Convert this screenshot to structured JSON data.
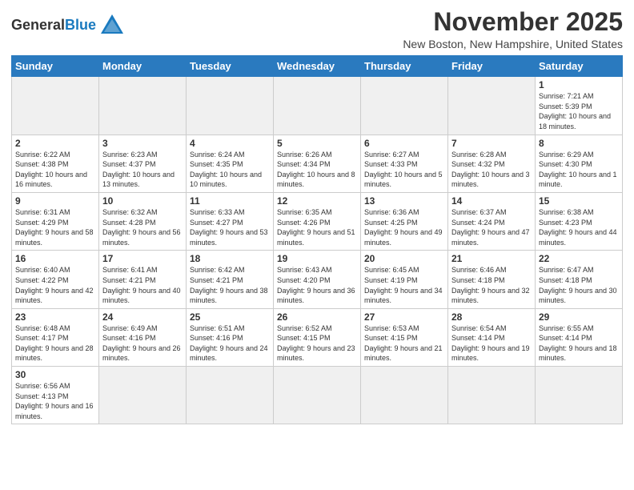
{
  "logo": {
    "text_general": "General",
    "text_blue": "Blue"
  },
  "header": {
    "month_year": "November 2025",
    "location": "New Boston, New Hampshire, United States"
  },
  "weekdays": [
    "Sunday",
    "Monday",
    "Tuesday",
    "Wednesday",
    "Thursday",
    "Friday",
    "Saturday"
  ],
  "weeks": [
    [
      {
        "day": "",
        "info": "",
        "empty": true
      },
      {
        "day": "",
        "info": "",
        "empty": true
      },
      {
        "day": "",
        "info": "",
        "empty": true
      },
      {
        "day": "",
        "info": "",
        "empty": true
      },
      {
        "day": "",
        "info": "",
        "empty": true
      },
      {
        "day": "",
        "info": "",
        "empty": true
      },
      {
        "day": "1",
        "info": "Sunrise: 7:21 AM\nSunset: 5:39 PM\nDaylight: 10 hours and 18 minutes.",
        "empty": false
      }
    ],
    [
      {
        "day": "2",
        "info": "Sunrise: 6:22 AM\nSunset: 4:38 PM\nDaylight: 10 hours and 16 minutes.",
        "empty": false
      },
      {
        "day": "3",
        "info": "Sunrise: 6:23 AM\nSunset: 4:37 PM\nDaylight: 10 hours and 13 minutes.",
        "empty": false
      },
      {
        "day": "4",
        "info": "Sunrise: 6:24 AM\nSunset: 4:35 PM\nDaylight: 10 hours and 10 minutes.",
        "empty": false
      },
      {
        "day": "5",
        "info": "Sunrise: 6:26 AM\nSunset: 4:34 PM\nDaylight: 10 hours and 8 minutes.",
        "empty": false
      },
      {
        "day": "6",
        "info": "Sunrise: 6:27 AM\nSunset: 4:33 PM\nDaylight: 10 hours and 5 minutes.",
        "empty": false
      },
      {
        "day": "7",
        "info": "Sunrise: 6:28 AM\nSunset: 4:32 PM\nDaylight: 10 hours and 3 minutes.",
        "empty": false
      },
      {
        "day": "8",
        "info": "Sunrise: 6:29 AM\nSunset: 4:30 PM\nDaylight: 10 hours and 1 minute.",
        "empty": false
      }
    ],
    [
      {
        "day": "9",
        "info": "Sunrise: 6:31 AM\nSunset: 4:29 PM\nDaylight: 9 hours and 58 minutes.",
        "empty": false
      },
      {
        "day": "10",
        "info": "Sunrise: 6:32 AM\nSunset: 4:28 PM\nDaylight: 9 hours and 56 minutes.",
        "empty": false
      },
      {
        "day": "11",
        "info": "Sunrise: 6:33 AM\nSunset: 4:27 PM\nDaylight: 9 hours and 53 minutes.",
        "empty": false
      },
      {
        "day": "12",
        "info": "Sunrise: 6:35 AM\nSunset: 4:26 PM\nDaylight: 9 hours and 51 minutes.",
        "empty": false
      },
      {
        "day": "13",
        "info": "Sunrise: 6:36 AM\nSunset: 4:25 PM\nDaylight: 9 hours and 49 minutes.",
        "empty": false
      },
      {
        "day": "14",
        "info": "Sunrise: 6:37 AM\nSunset: 4:24 PM\nDaylight: 9 hours and 47 minutes.",
        "empty": false
      },
      {
        "day": "15",
        "info": "Sunrise: 6:38 AM\nSunset: 4:23 PM\nDaylight: 9 hours and 44 minutes.",
        "empty": false
      }
    ],
    [
      {
        "day": "16",
        "info": "Sunrise: 6:40 AM\nSunset: 4:22 PM\nDaylight: 9 hours and 42 minutes.",
        "empty": false
      },
      {
        "day": "17",
        "info": "Sunrise: 6:41 AM\nSunset: 4:21 PM\nDaylight: 9 hours and 40 minutes.",
        "empty": false
      },
      {
        "day": "18",
        "info": "Sunrise: 6:42 AM\nSunset: 4:21 PM\nDaylight: 9 hours and 38 minutes.",
        "empty": false
      },
      {
        "day": "19",
        "info": "Sunrise: 6:43 AM\nSunset: 4:20 PM\nDaylight: 9 hours and 36 minutes.",
        "empty": false
      },
      {
        "day": "20",
        "info": "Sunrise: 6:45 AM\nSunset: 4:19 PM\nDaylight: 9 hours and 34 minutes.",
        "empty": false
      },
      {
        "day": "21",
        "info": "Sunrise: 6:46 AM\nSunset: 4:18 PM\nDaylight: 9 hours and 32 minutes.",
        "empty": false
      },
      {
        "day": "22",
        "info": "Sunrise: 6:47 AM\nSunset: 4:18 PM\nDaylight: 9 hours and 30 minutes.",
        "empty": false
      }
    ],
    [
      {
        "day": "23",
        "info": "Sunrise: 6:48 AM\nSunset: 4:17 PM\nDaylight: 9 hours and 28 minutes.",
        "empty": false
      },
      {
        "day": "24",
        "info": "Sunrise: 6:49 AM\nSunset: 4:16 PM\nDaylight: 9 hours and 26 minutes.",
        "empty": false
      },
      {
        "day": "25",
        "info": "Sunrise: 6:51 AM\nSunset: 4:16 PM\nDaylight: 9 hours and 24 minutes.",
        "empty": false
      },
      {
        "day": "26",
        "info": "Sunrise: 6:52 AM\nSunset: 4:15 PM\nDaylight: 9 hours and 23 minutes.",
        "empty": false
      },
      {
        "day": "27",
        "info": "Sunrise: 6:53 AM\nSunset: 4:15 PM\nDaylight: 9 hours and 21 minutes.",
        "empty": false
      },
      {
        "day": "28",
        "info": "Sunrise: 6:54 AM\nSunset: 4:14 PM\nDaylight: 9 hours and 19 minutes.",
        "empty": false
      },
      {
        "day": "29",
        "info": "Sunrise: 6:55 AM\nSunset: 4:14 PM\nDaylight: 9 hours and 18 minutes.",
        "empty": false
      }
    ],
    [
      {
        "day": "30",
        "info": "Sunrise: 6:56 AM\nSunset: 4:13 PM\nDaylight: 9 hours and 16 minutes.",
        "empty": false
      },
      {
        "day": "",
        "info": "",
        "empty": true
      },
      {
        "day": "",
        "info": "",
        "empty": true
      },
      {
        "day": "",
        "info": "",
        "empty": true
      },
      {
        "day": "",
        "info": "",
        "empty": true
      },
      {
        "day": "",
        "info": "",
        "empty": true
      },
      {
        "day": "",
        "info": "",
        "empty": true
      }
    ]
  ]
}
